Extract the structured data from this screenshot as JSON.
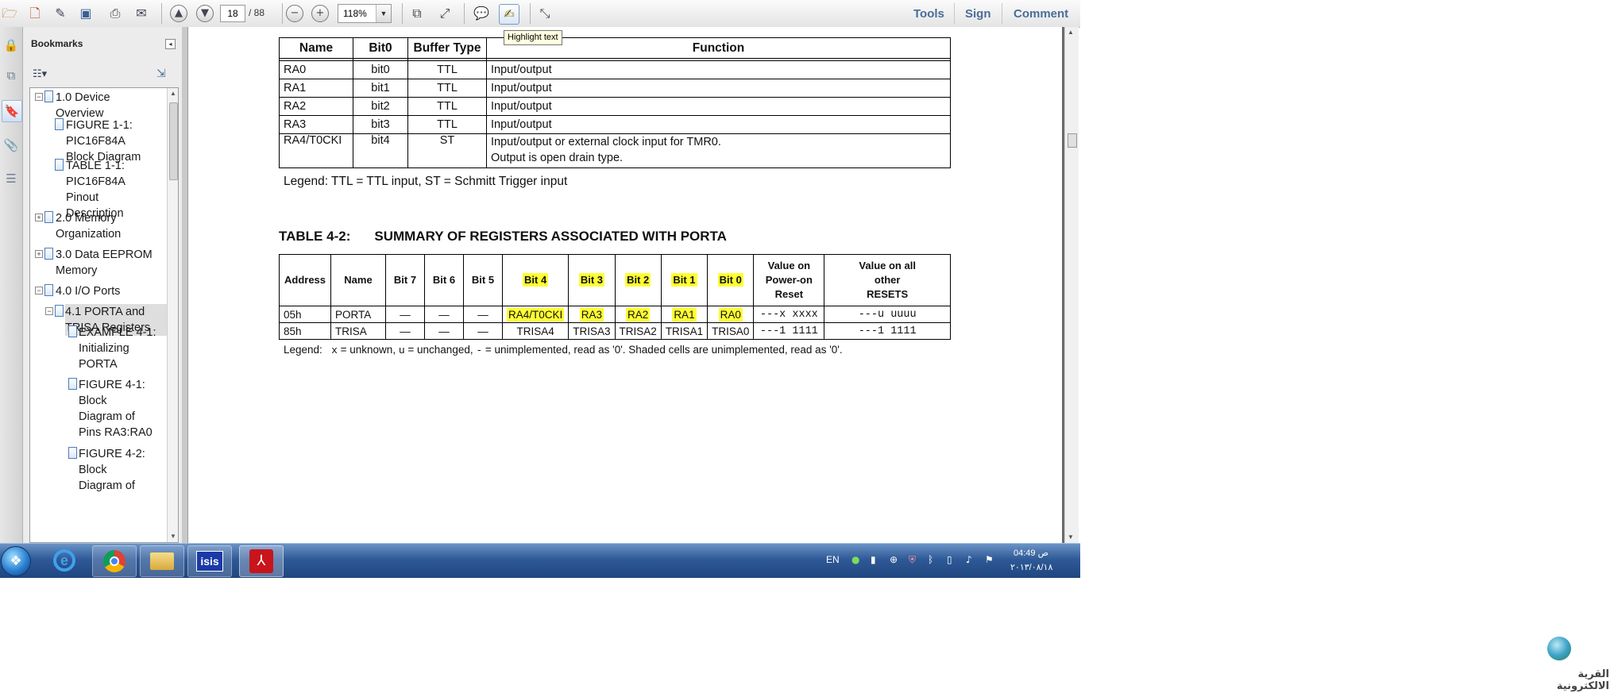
{
  "toolbar": {
    "page_number": "18",
    "page_total": "/ 88",
    "zoom": "118%",
    "tools_label": "Tools",
    "sign_label": "Sign",
    "comment_label": "Comment",
    "tooltip": "Highlight text",
    "icons": [
      "open-folder-icon",
      "create-pdf-icon",
      "edit-icon",
      "save-icon",
      "print-icon",
      "email-icon",
      "prev-page-icon",
      "next-page-icon",
      "zoom-out-icon",
      "zoom-in-icon",
      "fit-page-icon",
      "fit-width-icon",
      "sticky-note-icon",
      "highlight-text-icon",
      "full-screen-icon"
    ]
  },
  "bookmarks": {
    "title": "Bookmarks",
    "items": [
      {
        "line1": "1.0 Device",
        "line2": "Overview",
        "line3": ""
      },
      {
        "line1": "FIGURE 1-1:",
        "line2": "PIC16F84A",
        "line3": "Block Diagram"
      },
      {
        "line1": "TABLE 1-1:",
        "line2": "PIC16F84A",
        "line3": "Pinout"
      },
      {
        "line1": "Description",
        "line2": "",
        "line3": ""
      },
      {
        "line1": "2.0 Memory",
        "line2": "Organization",
        "line3": ""
      },
      {
        "line1": "3.0 Data EEPROM",
        "line2": "Memory",
        "line3": ""
      },
      {
        "line1": "4.0 I/O Ports",
        "line2": "",
        "line3": ""
      },
      {
        "line1": "4.1 PORTA and",
        "line2": "TRISA Registers",
        "line3": ""
      },
      {
        "line1": "EXAMPLE 4-1:",
        "line2": "Initializing",
        "line3": "PORTA"
      },
      {
        "line1": "FIGURE 4-1:",
        "line2": "Block",
        "line3": "Diagram of"
      },
      {
        "line1": "Pins RA3:RA0",
        "line2": "",
        "line3": ""
      },
      {
        "line1": "FIGURE 4-2:",
        "line2": "Block",
        "line3": "Diagram of"
      }
    ]
  },
  "table1": {
    "headers": [
      "Name",
      "Bit0",
      "Buffer Type",
      "Function"
    ],
    "rows": [
      [
        "RA0",
        "bit0",
        "TTL",
        "Input/output"
      ],
      [
        "RA1",
        "bit1",
        "TTL",
        "Input/output"
      ],
      [
        "RA2",
        "bit2",
        "TTL",
        "Input/output"
      ],
      [
        "RA3",
        "bit3",
        "TTL",
        "Input/output"
      ],
      [
        "RA4/T0CKI",
        "bit4",
        "ST",
        "Input/output or external clock input for TMR0."
      ]
    ],
    "row5_line2": "Output is open drain type.",
    "legend": "Legend:  TTL = TTL input, ST = Schmitt Trigger input"
  },
  "table2": {
    "number": "TABLE 4-2:",
    "title": "SUMMARY OF REGISTERS ASSOCIATED WITH PORTA",
    "headers": [
      "Address",
      "Name",
      "Bit 7",
      "Bit 6",
      "Bit 5",
      "Bit 4",
      "Bit 3",
      "Bit 2",
      "Bit 1",
      "Bit 0"
    ],
    "header_por": [
      "Value on",
      "Power-on",
      "Reset"
    ],
    "header_other": [
      "Value on all",
      "other",
      "RESETS"
    ],
    "rows": [
      [
        "05h",
        "PORTA",
        "—",
        "—",
        "—",
        "RA4/T0CKI",
        "RA3",
        "RA2",
        "RA1",
        "RA0",
        "---x xxxx",
        "---u uuuu"
      ],
      [
        "85h",
        "TRISA",
        "—",
        "—",
        "—",
        "TRISA4",
        "TRISA3",
        "TRISA2",
        "TRISA1",
        "TRISA0",
        "---1 1111",
        "---1 1111"
      ]
    ],
    "legend_prefix": "Legend:",
    "legend_x": "x",
    "legend_x_desc": " = unknown, ",
    "legend_u": "u",
    "legend_u_desc": " = unchanged, ",
    "legend_dash": "-",
    "legend_rest": " = unimplemented, read as '0'. Shaded cells are unimplemented, read as '0'."
  },
  "taskbar": {
    "apps": [
      "start-orb",
      "internet-explorer",
      "chrome",
      "explorer",
      "isis",
      "adobe-reader"
    ],
    "isis_label": "isis",
    "language": "EN",
    "time": "04:49 ص",
    "date": "٢٠١٣/٠٨/١٨"
  },
  "watermark": {
    "text": "القرية الالكترونية"
  }
}
